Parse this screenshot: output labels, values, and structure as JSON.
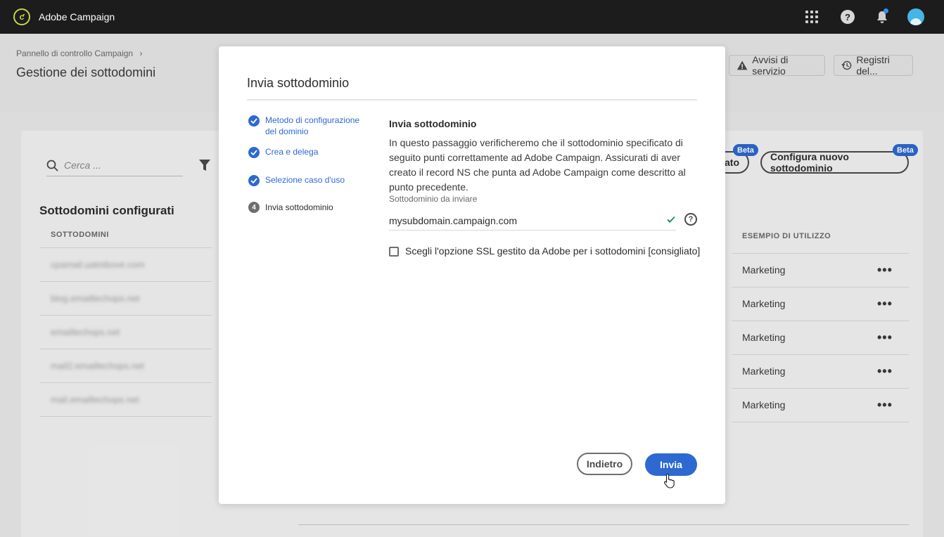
{
  "app": {
    "title": "Adobe Campaign"
  },
  "header": {
    "breadcrumb": "Pannello di controllo Campaign",
    "breadcrumb_chevron": "›",
    "page_title": "Gestione dei sottodomini",
    "alerts_label": "Avvisi di servizio",
    "logs_label": "Registri del..."
  },
  "card": {
    "search_placeholder": "Cerca ...",
    "section_title": "Sottodomini configurati",
    "col_subdomains": "SOTTODOMINI",
    "col_usage": "ESEMPIO DI UTILIZZO",
    "configure_button": "Configura nuovo sottodominio",
    "delegated_button_fragment": "ato",
    "beta": "Beta",
    "rows": [
      {
        "subdomain": "cpamail.uatmbove.com",
        "usage": "Marketing"
      },
      {
        "subdomain": "blog.emailtechops.net",
        "usage": "Marketing"
      },
      {
        "subdomain": "emailtechops.net",
        "usage": "Marketing"
      },
      {
        "subdomain": "mail2.emailtechops.net",
        "usage": "Marketing"
      },
      {
        "subdomain": "mail.emailtechops.net",
        "usage": "Marketing"
      }
    ],
    "more": "•••"
  },
  "modal": {
    "title": "Invia sottodominio",
    "steps": [
      {
        "label": "Metodo di configurazione del dominio",
        "state": "done"
      },
      {
        "label": "Crea e delega",
        "state": "done"
      },
      {
        "label": "Selezione caso d'uso",
        "state": "done"
      },
      {
        "label": "Invia sottodominio",
        "state": "current",
        "number": "4"
      }
    ],
    "content_title": "Invia sottodominio",
    "description": "In questo passaggio verificheremo che il sottodominio specificato di seguito punti correttamente ad Adobe Campaign. Assicurati di aver creato il record NS che punta ad Adobe Campaign come  descritto al punto precedente.",
    "field_label": "Sottodominio da inviare",
    "field_value": "mysubdomain.campaign.com",
    "help": "?",
    "ssl_label": "Scegli l'opzione SSL gestito da Adobe per i sottodomini [consigliato]",
    "back_label": "Indietro",
    "submit_label": "Invia"
  },
  "colors": {
    "accent": "#2d69d1",
    "topbar": "#1c1c1c",
    "success": "#268e6c"
  }
}
